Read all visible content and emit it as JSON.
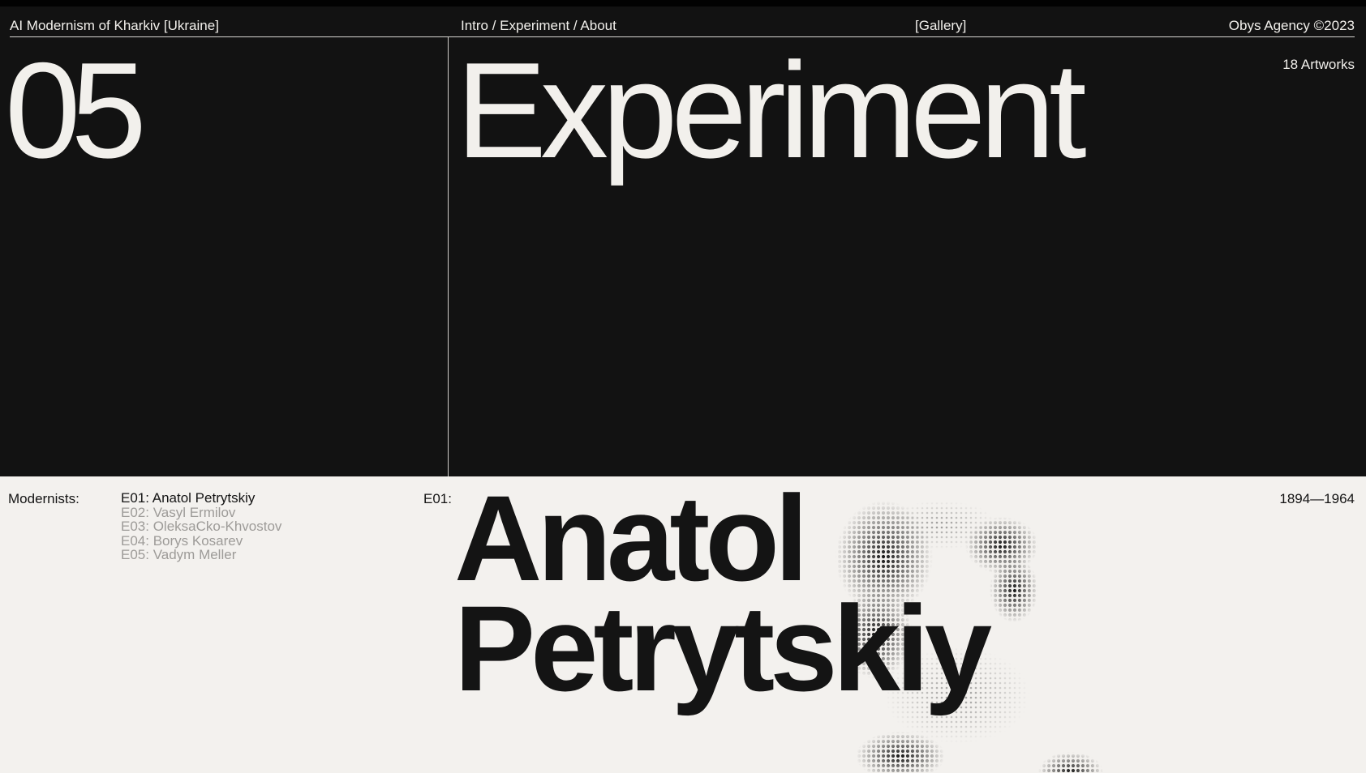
{
  "header": {
    "site_title": "AI Modernism of Kharkiv [Ukraine]",
    "nav": "Intro / Experiment / About",
    "gallery_link": "[Gallery]",
    "credit": "Obys Agency ©2023"
  },
  "section": {
    "number": "05",
    "title": "Experiment",
    "artworks_count": "18 Artworks"
  },
  "modernists": {
    "label": "Modernists:",
    "items": [
      {
        "label": "E01: Anatol Petrytskiy",
        "active": true
      },
      {
        "label": "E02: Vasyl Ermilov",
        "active": false
      },
      {
        "label": "E03: OleksaCko-Khvostov",
        "active": false
      },
      {
        "label": "E04: Borys Kosarev",
        "active": false
      },
      {
        "label": "E05: Vadym Meller",
        "active": false
      }
    ]
  },
  "feature": {
    "code": "E01:",
    "first_name": "Anatol",
    "last_name": "Petrytskiy",
    "years": "1894—1964"
  },
  "colors": {
    "dark_bg": "#121212",
    "light_bg": "#f3f1ee",
    "text_light": "#f2f0ec",
    "text_dark": "#141414",
    "muted": "#9d9b98"
  }
}
